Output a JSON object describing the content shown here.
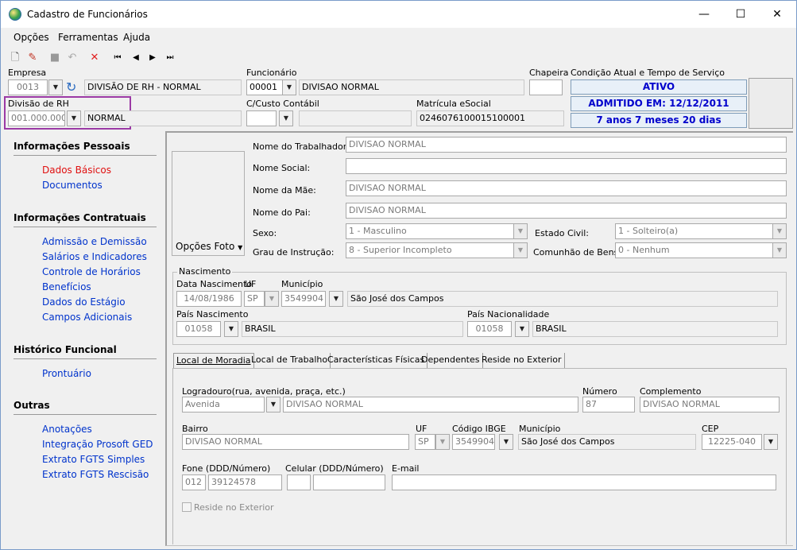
{
  "window": {
    "title": "Cadastro de Funcionários",
    "minimize": "—",
    "maximize": "☐",
    "close": "✕"
  },
  "menu": {
    "opcoes": "Opções",
    "ferramentas": "Ferramentas",
    "ajuda": "Ajuda"
  },
  "toolbar": {
    "icons": [
      "new-icon",
      "edit-icon",
      "stop-icon",
      "undo-icon",
      "delete-icon",
      "first-icon",
      "prev-icon",
      "next-icon",
      "last-icon"
    ],
    "glyphs": {
      "new": "🗋",
      "edit": "✎",
      "stop": "■",
      "undo": "↶",
      "delete": "✕",
      "first": "⏮",
      "prev": "◀",
      "next": "▶",
      "last": "⏭"
    }
  },
  "header": {
    "empresa_label": "Empresa",
    "empresa_code": "0013",
    "empresa_name": "DIVISÃO DE RH - NORMAL",
    "funcionario_label": "Funcionário",
    "funcionario_code": "00001",
    "funcionario_name": "DIVISAO NORMAL",
    "chapeira_label": "Chapeira",
    "chapeira_value": "",
    "condicao_label": "Condição Atual e Tempo de Serviço",
    "status_ativo": "ATIVO",
    "status_admitido": "ADMITIDO EM: 12/12/2011",
    "status_tempo": "7 anos 7 meses 20 dias",
    "divisao_label": "Divisão de RH",
    "divisao_code": "001.000.000",
    "divisao_name": "NORMAL",
    "ccusto_label": "C/Custo Contábil",
    "ccusto_code": "",
    "ccusto_name": "",
    "matricula_label": "Matrícula eSocial",
    "matricula_value": "0246076100015100001"
  },
  "sidebar": {
    "sections": [
      {
        "title": "Informações Pessoais",
        "items": [
          "Dados Básicos",
          "Documentos"
        ]
      },
      {
        "title": "Informações Contratuais",
        "items": [
          "Admissão e Demissão",
          "Salários e Indicadores",
          "Controle de Horários",
          "Benefícios",
          "Dados do Estágio",
          "Campos Adicionais"
        ]
      },
      {
        "title": "Histórico Funcional",
        "items": [
          "Prontuário"
        ]
      },
      {
        "title": "Outras",
        "items": [
          "Anotações",
          "Integração Prosoft GED",
          "Extrato FGTS Simples",
          "Extrato FGTS Rescisão"
        ]
      }
    ]
  },
  "dados": {
    "opcoes_foto": "Opções Foto",
    "nome_trabalhador_label": "Nome do Trabalhador:",
    "nome_trabalhador": "DIVISAO NORMAL",
    "nome_social_label": "Nome Social:",
    "nome_social": "",
    "nome_mae_label": "Nome da Mãe:",
    "nome_mae": "DIVISAO NORMAL",
    "nome_pai_label": "Nome do Pai:",
    "nome_pai": "DIVISAO NORMAL",
    "sexo_label": "Sexo:",
    "sexo": "1 - Masculino",
    "estado_civil_label": "Estado Civil:",
    "estado_civil": "1 - Solteiro(a)",
    "grau_label": "Grau de Instrução:",
    "grau": "8 - Superior Incompleto",
    "comunhao_label": "Comunhão de Bens:",
    "comunhao": "0 - Nenhum"
  },
  "nascimento": {
    "group_label": "Nascimento",
    "data_label": "Data Nascimento",
    "data": "14/08/1986",
    "uf_label": "UF",
    "uf": "SP",
    "municipio_label": "Município",
    "municipio_code": "3549904",
    "municipio_name": "São José dos Campos",
    "pais_nasc_label": "País Nascimento",
    "pais_nasc_code": "01058",
    "pais_nasc_name": "BRASIL",
    "pais_nac_label": "País Nacionalidade",
    "pais_nac_code": "01058",
    "pais_nac_name": "BRASIL"
  },
  "tabs": [
    "Local de Moradia",
    "Local de Trabalho",
    "Características Físicas",
    "Dependentes",
    "Reside no Exterior"
  ],
  "moradia": {
    "logradouro_label": "Logradouro(rua, avenida, praça, etc.)",
    "logradouro_tipo": "Avenida",
    "logradouro": "DIVISAO NORMAL",
    "numero_label": "Número",
    "numero": "87",
    "complemento_label": "Complemento",
    "complemento": "DIVISAO NORMAL",
    "bairro_label": "Bairro",
    "bairro": "DIVISAO NORMAL",
    "uf_label": "UF",
    "uf": "SP",
    "ibge_label": "Código IBGE",
    "ibge": "3549904",
    "municipio_label": "Município",
    "municipio": "São José dos Campos",
    "cep_label": "CEP",
    "cep": "12225-040",
    "fone_label": "Fone (DDD/Número)",
    "fone_ddd": "012",
    "fone_num": "39124578",
    "celular_label": "Celular (DDD/Número)",
    "celular_ddd": "",
    "celular_num": "",
    "email_label": "E-mail",
    "email": "",
    "reside_label": "Reside no Exterior"
  }
}
